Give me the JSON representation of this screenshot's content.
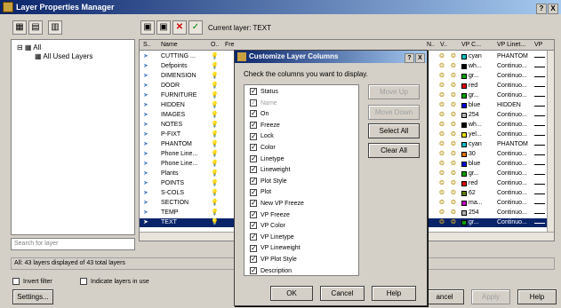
{
  "window": {
    "title": "Layer Properties Manager",
    "help_btn": "?",
    "close_btn": "X"
  },
  "toolbar": {
    "current_layer": "Current layer: TEXT"
  },
  "tree": {
    "root": "All",
    "child": "All Used Layers"
  },
  "search": {
    "placeholder": "Search for layer"
  },
  "grid": {
    "headers": [
      "S..",
      "Name",
      "O..",
      "Fre",
      "N..",
      "V..",
      "VP C...",
      "VP Linet...",
      "VP"
    ],
    "rows": [
      {
        "name": "CUTTING ...",
        "color": "cyan",
        "swatch": "#00c0c0",
        "ltype": "PHANTOM"
      },
      {
        "name": "Defpoints",
        "color": "wh...",
        "swatch": "#000000",
        "ltype": "Continuo..."
      },
      {
        "name": "DIMENSION",
        "color": "gr...",
        "swatch": "#00a000",
        "ltype": "Continuo..."
      },
      {
        "name": "DOOR",
        "color": "red",
        "swatch": "#e00000",
        "ltype": "Continuo..."
      },
      {
        "name": "FURNITURE",
        "color": "gr...",
        "swatch": "#00a000",
        "ltype": "Continuo..."
      },
      {
        "name": "HIDDEN",
        "color": "blue",
        "swatch": "#0000e0",
        "ltype": "HIDDEN"
      },
      {
        "name": "IMAGES",
        "color": "254",
        "swatch": "#b0b0b0",
        "ltype": "Continuo..."
      },
      {
        "name": "NOTES",
        "color": "wh...",
        "swatch": "#000000",
        "ltype": "Continuo..."
      },
      {
        "name": "P-FIXT",
        "color": "yel...",
        "swatch": "#e0e000",
        "ltype": "Continuo..."
      },
      {
        "name": "PHANTOM",
        "color": "cyan",
        "swatch": "#00c0c0",
        "ltype": "PHANTOM"
      },
      {
        "name": "Phone Line...",
        "color": "30",
        "swatch": "#e07000",
        "ltype": "Continuo..."
      },
      {
        "name": "Phone Line...",
        "color": "blue",
        "swatch": "#0000e0",
        "ltype": "Continuo..."
      },
      {
        "name": "Plants",
        "color": "gr...",
        "swatch": "#00a000",
        "ltype": "Continuo..."
      },
      {
        "name": "POINTS",
        "color": "red",
        "swatch": "#e00000",
        "ltype": "Continuo..."
      },
      {
        "name": "S-COLS",
        "color": "62",
        "swatch": "#608000",
        "ltype": "Continuo..."
      },
      {
        "name": "SECTION",
        "color": "ma...",
        "swatch": "#c000c0",
        "ltype": "Continuo..."
      },
      {
        "name": "TEMP",
        "color": "254",
        "swatch": "#b0b0b0",
        "ltype": "Continuo..."
      },
      {
        "name": "TEXT",
        "color": "gr...",
        "swatch": "#00a000",
        "ltype": "Continuo..."
      }
    ]
  },
  "status": {
    "text": "All: 43 layers displayed of 43 total layers"
  },
  "bottom": {
    "invert_filter": "Invert filter",
    "indicate_layers": "Indicate layers in use",
    "settings": "Settings...",
    "cancel_partial": "ancel",
    "apply": "Apply",
    "help": "Help"
  },
  "dialog": {
    "title": "Customize Layer Columns",
    "help_btn": "?",
    "close_btn": "X",
    "prompt": "Check the columns you want to display.",
    "items": [
      "Status",
      "Name",
      "On",
      "Freeze",
      "Lock",
      "Color",
      "Linetype",
      "Lineweight",
      "Plot Style",
      "Plot",
      "New VP Freeze",
      "VP Freeze",
      "VP Color",
      "VP Linetype",
      "VP Lineweight",
      "VP Plot Style",
      "Description"
    ],
    "move_up": "Move Up",
    "move_down": "Move Down",
    "select_all": "Select All",
    "clear_all": "Clear All",
    "ok": "OK",
    "cancel": "Cancel",
    "help": "Help"
  }
}
